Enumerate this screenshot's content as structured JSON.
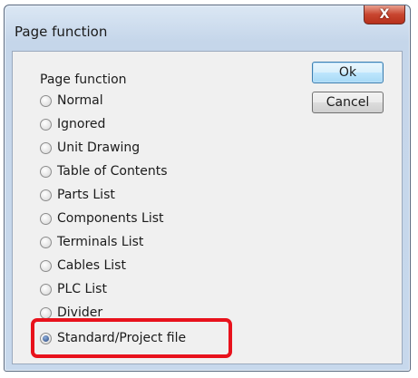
{
  "window": {
    "title": "Page function",
    "close_label": "X"
  },
  "group": {
    "label": "Page function",
    "options": [
      {
        "label": "Normal",
        "checked": false
      },
      {
        "label": "Ignored",
        "checked": false
      },
      {
        "label": "Unit Drawing",
        "checked": false
      },
      {
        "label": "Table of Contents",
        "checked": false
      },
      {
        "label": "Parts List",
        "checked": false
      },
      {
        "label": "Components List",
        "checked": false
      },
      {
        "label": "Terminals List",
        "checked": false
      },
      {
        "label": "Cables List",
        "checked": false
      },
      {
        "label": "PLC List",
        "checked": false
      },
      {
        "label": "Divider",
        "checked": false
      },
      {
        "label": "Standard/Project file",
        "checked": true
      }
    ]
  },
  "buttons": {
    "ok_label": "Ok",
    "cancel_label": "Cancel"
  },
  "annotation": {
    "highlight_color": "#e8121c"
  }
}
